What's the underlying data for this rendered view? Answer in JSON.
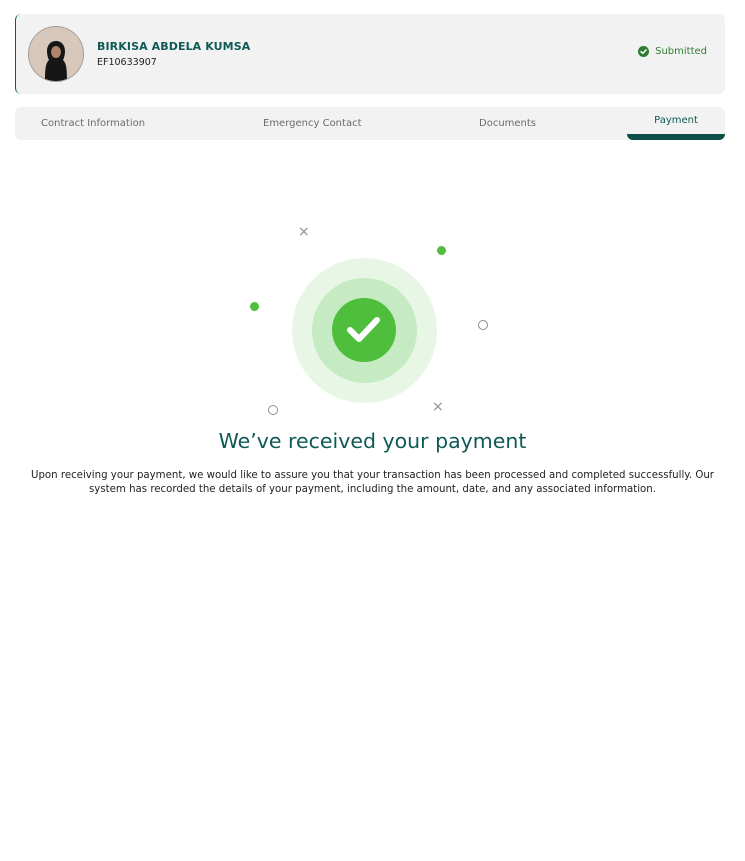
{
  "profile": {
    "name": "BIRKISA ABDELA KUMSA",
    "employee_id": "EF10633907",
    "status": "Submitted",
    "status_icon": "check-circle-icon"
  },
  "tabs": [
    {
      "label": "Contract Information"
    },
    {
      "label": "Emergency Contact"
    },
    {
      "label": "Documents"
    },
    {
      "label": "Payment",
      "active": true
    }
  ],
  "confirmation": {
    "title": "We’ve received your payment",
    "message": "Upon receiving your payment, we would like to assure you that your transaction has been processed and completed successfully. Our system has recorded the details of your payment, including the amount, date, and any associated information.",
    "icon": "check-icon"
  },
  "colors": {
    "brand": "#0f5a55",
    "success": "#4fbe3d",
    "tab_bg": "#f2f2f2"
  }
}
